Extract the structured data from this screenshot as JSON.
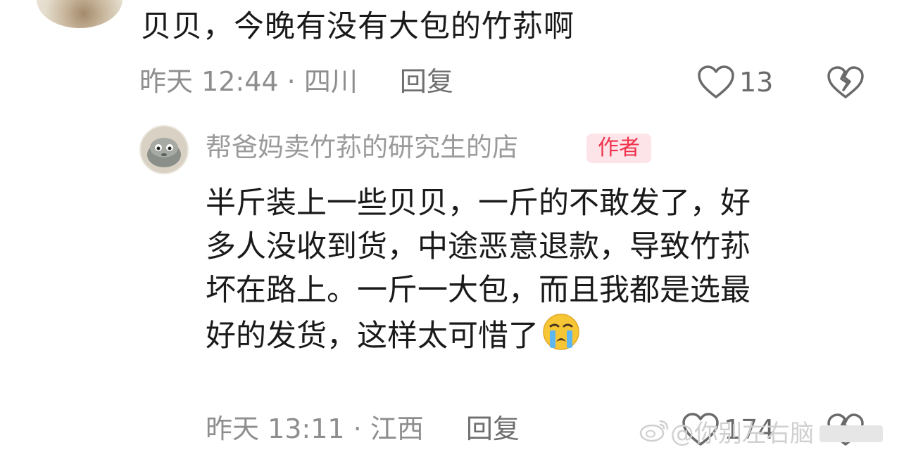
{
  "comment": {
    "text": "贝贝，今晚有没有大包的竹荪啊",
    "time_location": "昨天 12:44 · 四川",
    "reply_label": "回复",
    "like_count": "13"
  },
  "reply": {
    "author": "帮爸妈卖竹荪的研究生的店",
    "badge": "作者",
    "lines": [
      "半斤装上一些贝贝，一斤的不敢发了，好",
      "多人没收到货，中途恶意退款，导致竹荪",
      "坏在路上。一斤一大包，而且我都是选最",
      "好的发货，这样太可惜了"
    ],
    "time_location": "昨天 13:11 · 江西",
    "reply_label": "回复",
    "like_count": "174"
  },
  "watermark": {
    "text": "@你别左右脑"
  },
  "icons": {
    "like": "heart-outline-icon",
    "dislike": "broken-heart-icon",
    "emoji": "crying-face-emoji"
  },
  "colors": {
    "badge_text": "#f0324c",
    "badge_bg": "#fde4e8",
    "meta_text": "#8e8e8e",
    "body_text": "#1a1a1a"
  }
}
